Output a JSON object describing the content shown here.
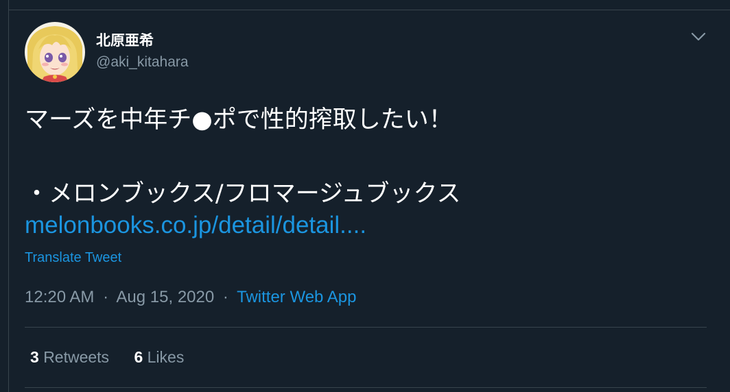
{
  "tweet": {
    "author": {
      "display_name": "北原亜希",
      "handle": "@aki_kitahara"
    },
    "text_line1": "マーズを中年チ●ポで性的搾取したい！",
    "text_line2": "・メロンブックス/フロマージュブックス",
    "link_text": "melonbooks.co.jp/detail/detail....",
    "translate_label": "Translate Tweet",
    "time": "12:20 AM",
    "date": "Aug 15, 2020",
    "separator": "·",
    "source": "Twitter Web App",
    "retweets_count": "3",
    "retweets_label": "Retweets",
    "likes_count": "6",
    "likes_label": "Likes"
  },
  "icons": {
    "caret": "chevron-down-icon"
  },
  "colors": {
    "background": "#15202b",
    "border": "#38444d",
    "accent": "#1b95e0",
    "secondary_text": "#8899a6",
    "primary_text": "#ffffff"
  }
}
